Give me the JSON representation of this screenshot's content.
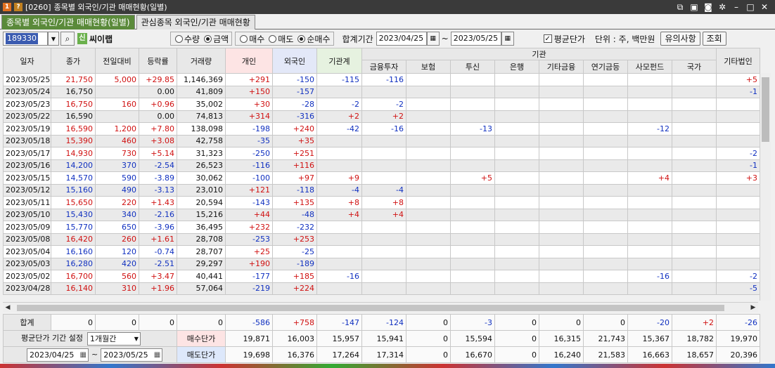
{
  "title": {
    "code_num": "[0260]",
    "text": "종목별 외국인/기관 매매현황(일별)"
  },
  "tabs": [
    "종목별 외국인/기관 매매현황(일별)",
    "관심종목 외국인/기관 매매현황"
  ],
  "toolbar": {
    "code": "189330",
    "sin": "신",
    "name": "씨이랩",
    "mode_options": [
      "수량",
      "금액"
    ],
    "mode_selected": "금액",
    "trade_options": [
      "매수",
      "매도",
      "순매수"
    ],
    "trade_selected": "순매수",
    "period_label": "합계기간",
    "start_date": "2023/04/25",
    "tilde": "~",
    "end_date": "2023/05/25",
    "avg_check": "평균단가",
    "unit": "단위 : 주, 백만원",
    "notice_btn": "유의사항",
    "query_btn": "조회"
  },
  "headers": {
    "date": "일자",
    "close": "종가",
    "change": "전일대비",
    "rate": "등락률",
    "volume": "거래량",
    "individual": "개인",
    "foreign": "외국인",
    "inst_total": "기관계",
    "inst_group": "기관",
    "inst_cols": [
      "금융투자",
      "보험",
      "투신",
      "은행",
      "기타금융",
      "연기금등",
      "사모펀드",
      "국가"
    ],
    "other_corp": "기타법인"
  },
  "rows": [
    {
      "d": "2023/05/25",
      "p": "21,750",
      "pc": "r",
      "c": "5,000",
      "cc": "r",
      "rt": "+29.85",
      "rc": "r",
      "v": "1,146,369",
      "i": "+291",
      "f": "-150",
      "t": "-115",
      "x": [
        "-116",
        "",
        "",
        "",
        "",
        "",
        "",
        ""
      ],
      "o": "+5"
    },
    {
      "d": "2023/05/24",
      "p": "16,750",
      "pc": "",
      "c": "",
      "cc": "",
      "rt": "0.00",
      "rc": "",
      "v": "41,809",
      "i": "+150",
      "f": "-157",
      "t": "",
      "x": [
        "",
        "",
        "",
        "",
        "",
        "",
        "",
        ""
      ],
      "o": "-1"
    },
    {
      "d": "2023/05/23",
      "p": "16,750",
      "pc": "r",
      "c": "160",
      "cc": "r",
      "rt": "+0.96",
      "rc": "r",
      "v": "35,002",
      "i": "+30",
      "f": "-28",
      "t": "-2",
      "x": [
        "-2",
        "",
        "",
        "",
        "",
        "",
        "",
        ""
      ],
      "o": ""
    },
    {
      "d": "2023/05/22",
      "p": "16,590",
      "pc": "",
      "c": "",
      "cc": "",
      "rt": "0.00",
      "rc": "",
      "v": "74,813",
      "i": "+314",
      "f": "-316",
      "t": "+2",
      "x": [
        "+2",
        "",
        "",
        "",
        "",
        "",
        "",
        ""
      ],
      "o": ""
    },
    {
      "d": "2023/05/19",
      "p": "16,590",
      "pc": "r",
      "c": "1,200",
      "cc": "r",
      "rt": "+7.80",
      "rc": "r",
      "v": "138,098",
      "i": "-198",
      "f": "+240",
      "t": "-42",
      "x": [
        "-16",
        "",
        "-13",
        "",
        "",
        "",
        "-12",
        ""
      ],
      "o": ""
    },
    {
      "d": "2023/05/18",
      "p": "15,390",
      "pc": "r",
      "c": "460",
      "cc": "r",
      "rt": "+3.08",
      "rc": "r",
      "v": "42,758",
      "i": "-35",
      "f": "+35",
      "t": "",
      "x": [
        "",
        "",
        "",
        "",
        "",
        "",
        "",
        ""
      ],
      "o": ""
    },
    {
      "d": "2023/05/17",
      "p": "14,930",
      "pc": "r",
      "c": "730",
      "cc": "r",
      "rt": "+5.14",
      "rc": "r",
      "v": "31,323",
      "i": "-250",
      "f": "+251",
      "t": "",
      "x": [
        "",
        "",
        "",
        "",
        "",
        "",
        "",
        ""
      ],
      "o": "-2"
    },
    {
      "d": "2023/05/16",
      "p": "14,200",
      "pc": "b",
      "c": "370",
      "cc": "b",
      "rt": "-2.54",
      "rc": "b",
      "v": "26,523",
      "i": "-116",
      "f": "+116",
      "t": "",
      "x": [
        "",
        "",
        "",
        "",
        "",
        "",
        "",
        ""
      ],
      "o": "-1"
    },
    {
      "d": "2023/05/15",
      "p": "14,570",
      "pc": "b",
      "c": "590",
      "cc": "b",
      "rt": "-3.89",
      "rc": "b",
      "v": "30,062",
      "i": "-100",
      "f": "+97",
      "t": "+9",
      "x": [
        "",
        "",
        "+5",
        "",
        "",
        "",
        "+4",
        ""
      ],
      "o": "+3"
    },
    {
      "d": "2023/05/12",
      "p": "15,160",
      "pc": "b",
      "c": "490",
      "cc": "b",
      "rt": "-3.13",
      "rc": "b",
      "v": "23,010",
      "i": "+121",
      "f": "-118",
      "t": "-4",
      "x": [
        "-4",
        "",
        "",
        "",
        "",
        "",
        "",
        ""
      ],
      "o": ""
    },
    {
      "d": "2023/05/11",
      "p": "15,650",
      "pc": "r",
      "c": "220",
      "cc": "r",
      "rt": "+1.43",
      "rc": "r",
      "v": "20,594",
      "i": "-143",
      "f": "+135",
      "t": "+8",
      "x": [
        "+8",
        "",
        "",
        "",
        "",
        "",
        "",
        ""
      ],
      "o": ""
    },
    {
      "d": "2023/05/10",
      "p": "15,430",
      "pc": "b",
      "c": "340",
      "cc": "b",
      "rt": "-2.16",
      "rc": "b",
      "v": "15,216",
      "i": "+44",
      "f": "-48",
      "t": "+4",
      "x": [
        "+4",
        "",
        "",
        "",
        "",
        "",
        "",
        ""
      ],
      "o": ""
    },
    {
      "d": "2023/05/09",
      "p": "15,770",
      "pc": "b",
      "c": "650",
      "cc": "b",
      "rt": "-3.96",
      "rc": "b",
      "v": "36,495",
      "i": "+232",
      "f": "-232",
      "t": "",
      "x": [
        "",
        "",
        "",
        "",
        "",
        "",
        "",
        ""
      ],
      "o": ""
    },
    {
      "d": "2023/05/08",
      "p": "16,420",
      "pc": "r",
      "c": "260",
      "cc": "r",
      "rt": "+1.61",
      "rc": "r",
      "v": "28,708",
      "i": "-253",
      "f": "+253",
      "t": "",
      "x": [
        "",
        "",
        "",
        "",
        "",
        "",
        "",
        ""
      ],
      "o": ""
    },
    {
      "d": "2023/05/04",
      "p": "16,160",
      "pc": "b",
      "c": "120",
      "cc": "b",
      "rt": "-0.74",
      "rc": "b",
      "v": "28,707",
      "i": "+25",
      "f": "-25",
      "t": "",
      "x": [
        "",
        "",
        "",
        "",
        "",
        "",
        "",
        ""
      ],
      "o": ""
    },
    {
      "d": "2023/05/03",
      "p": "16,280",
      "pc": "b",
      "c": "420",
      "cc": "b",
      "rt": "-2.51",
      "rc": "b",
      "v": "29,297",
      "i": "+190",
      "f": "-189",
      "t": "",
      "x": [
        "",
        "",
        "",
        "",
        "",
        "",
        "",
        ""
      ],
      "o": ""
    },
    {
      "d": "2023/05/02",
      "p": "16,700",
      "pc": "r",
      "c": "560",
      "cc": "r",
      "rt": "+3.47",
      "rc": "r",
      "v": "40,441",
      "i": "-177",
      "f": "+185",
      "t": "-16",
      "x": [
        "",
        "",
        "",
        "",
        "",
        "",
        "-16",
        ""
      ],
      "o": "-2"
    },
    {
      "d": "2023/04/28",
      "p": "16,140",
      "pc": "r",
      "c": "310",
      "cc": "r",
      "rt": "+1.96",
      "rc": "r",
      "v": "57,064",
      "i": "-219",
      "f": "+224",
      "t": "",
      "x": [
        "",
        "",
        "",
        "",
        "",
        "",
        "",
        ""
      ],
      "o": "-5"
    }
  ],
  "totals": {
    "label": "합계",
    "p": "0",
    "c": "0",
    "rt": "0",
    "v": "0",
    "i": "-586",
    "f": "+758",
    "t": "-147",
    "x": [
      "-124",
      "0",
      "-3",
      "0",
      "0",
      "0",
      "-20",
      "+2"
    ],
    "o": "-26"
  },
  "footer": {
    "avg_label": "평균단가 기간 설정",
    "period_select": "1개월간",
    "start_date": "2023/04/25",
    "tilde": "~",
    "end_date": "2023/05/25",
    "buy_label": "매수단가",
    "sell_label": "매도단가",
    "buy": [
      "19,871",
      "16,003",
      "15,957",
      "15,941",
      "0",
      "15,594",
      "0",
      "16,315",
      "21,743",
      "15,367",
      "18,782",
      "19,970"
    ],
    "sell": [
      "19,698",
      "16,376",
      "17,264",
      "17,314",
      "0",
      "16,670",
      "0",
      "16,240",
      "21,583",
      "16,663",
      "18,657",
      "20,396"
    ]
  },
  "colors": {
    "up": "#d01010",
    "down": "#1030c0",
    "tab_active": "#5a8a3a"
  }
}
